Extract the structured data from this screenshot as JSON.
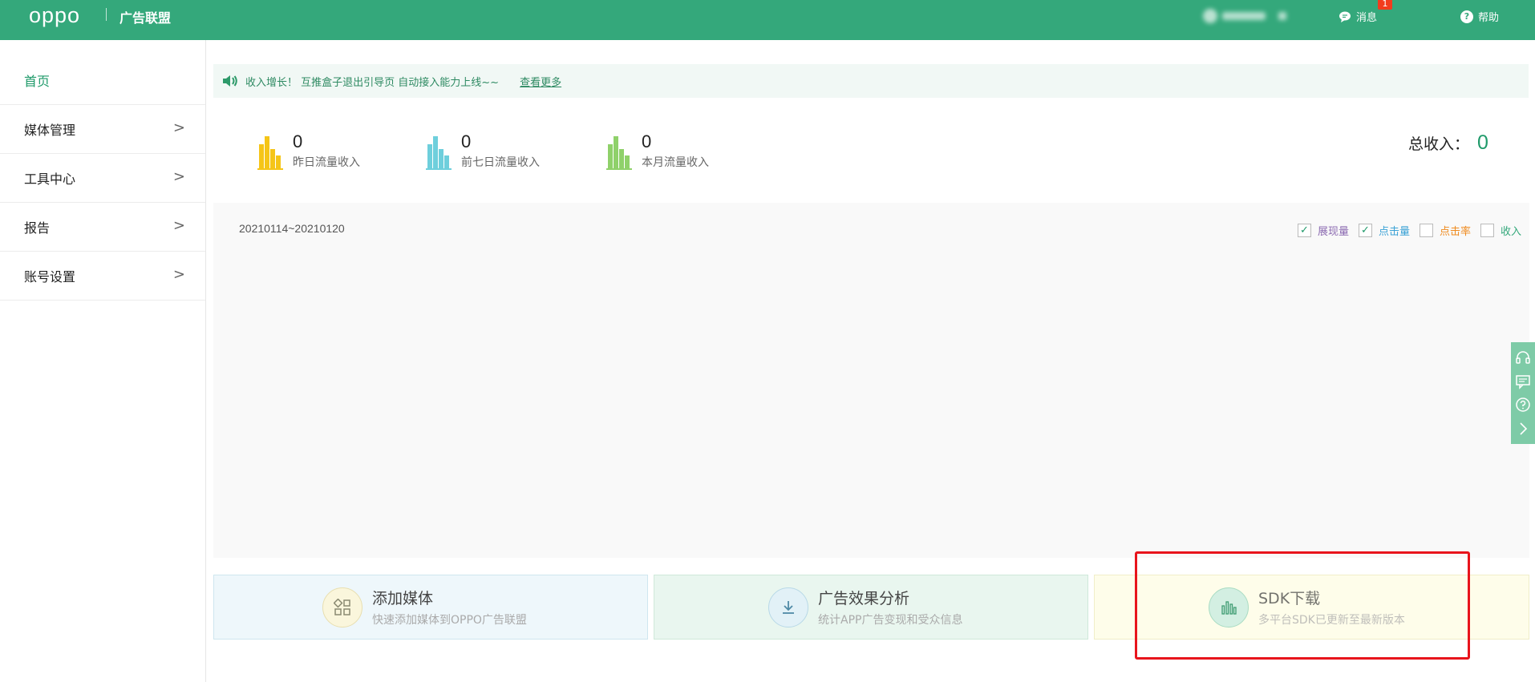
{
  "header": {
    "logo": "oppo",
    "subtitle": "广告联盟",
    "messages_label": "消息",
    "messages_badge": "1",
    "help_label": "帮助"
  },
  "sidebar": {
    "items": [
      {
        "label": "首页",
        "active": true
      },
      {
        "label": "媒体管理",
        "arrow": ">"
      },
      {
        "label": "工具中心",
        "arrow": ">"
      },
      {
        "label": "报告",
        "arrow": ">"
      },
      {
        "label": "账号设置",
        "arrow": ">"
      }
    ]
  },
  "notice": {
    "text": "收入增长！ 互推盒子退出引导页 自动接入能力上线~~",
    "link": "查看更多"
  },
  "stats": [
    {
      "value": "0",
      "label": "昨日流量收入",
      "color": "#f5c518"
    },
    {
      "value": "0",
      "label": "前七日流量收入",
      "color": "#6ecfdc"
    },
    {
      "value": "0",
      "label": "本月流量收入",
      "color": "#8fd16a"
    }
  ],
  "total": {
    "label": "总收入：",
    "value": "0"
  },
  "chart": {
    "date_range": "20210114~20210120",
    "legend": [
      {
        "label": "展现量",
        "checked": true,
        "color": "#8c6bb1"
      },
      {
        "label": "点击量",
        "checked": true,
        "color": "#3ba2d6"
      },
      {
        "label": "点击率",
        "checked": false,
        "color": "#ef8a1d"
      },
      {
        "label": "收入",
        "checked": false,
        "color": "#34a87b"
      }
    ]
  },
  "cards": [
    {
      "title": "添加媒体",
      "desc": "快速添加媒体到OPPO广告联盟",
      "icon": "grid-icon"
    },
    {
      "title": "广告效果分析",
      "desc": "统计APP广告变现和受众信息",
      "icon": "download-icon"
    },
    {
      "title": "SDK下载",
      "desc": "多平台SDK已更新至最新版本",
      "icon": "bar-chart-icon"
    }
  ],
  "float_bar": [
    "headset-icon",
    "comment-icon",
    "question-icon",
    "chevron-right-icon"
  ]
}
